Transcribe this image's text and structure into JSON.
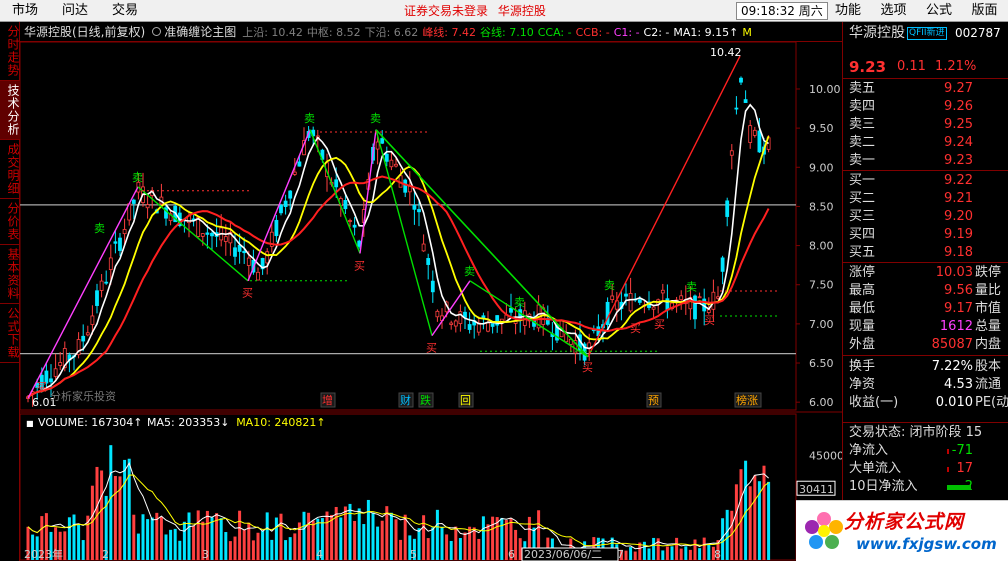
{
  "menu": {
    "left": [
      "市场",
      "问达",
      "交易"
    ],
    "center": [
      "证券交易未登录",
      "华源控股"
    ],
    "clock": "09:18:32 周六",
    "right": [
      "功能",
      "选项",
      "公式",
      "版面"
    ]
  },
  "left_tabs": [
    "分时走势",
    "技术分析",
    "成交明细",
    "分价表",
    "基本资料",
    "公式下载"
  ],
  "chart_header": {
    "stock": "华源控股(日线,前复权)",
    "indicator": "准确缠论主图",
    "legend": [
      {
        "text": "上沿: 10.42",
        "color": "#808080"
      },
      {
        "text": "中枢: 8.52",
        "color": "#808080"
      },
      {
        "text": "下沿: 6.62",
        "color": "#808080"
      },
      {
        "text": "峰线: 7.42",
        "color": "#ff3030"
      },
      {
        "text": "谷线: 7.10",
        "color": "#00e000"
      },
      {
        "text": "CCA: -",
        "color": "#00e000"
      },
      {
        "text": "CCB: -",
        "color": "#ff3030"
      },
      {
        "text": "C1: -",
        "color": "#ff40ff"
      },
      {
        "text": "C2: -",
        "color": "#ffffff"
      },
      {
        "text": "MA1: 9.15↑",
        "color": "#ffffff"
      },
      {
        "text": "M",
        "color": "#ffff00"
      }
    ]
  },
  "price_axis": [
    "10.00",
    "9.50",
    "9.00",
    "8.50",
    "8.00",
    "7.50",
    "7.00",
    "6.50",
    "6.00"
  ],
  "price_labels": {
    "high": "10.42",
    "low": "6.01",
    "watermark_text": "分析家乐投资"
  },
  "event_marks": [
    {
      "text": "增",
      "color": "#ff3030"
    },
    {
      "text": "财",
      "color": "#00bfff"
    },
    {
      "text": "跌",
      "color": "#00e000"
    },
    {
      "text": "回",
      "color": "#ffff00"
    },
    {
      "text": "预",
      "color": "#ffa500"
    },
    {
      "text": "榜涨",
      "color": "#ffa500"
    }
  ],
  "signal_labels": {
    "sell": "卖",
    "buy": "买"
  },
  "volume_header": [
    {
      "text": "VOLUME: 167304↑",
      "color": "#ffffff"
    },
    {
      "text": "MA5: 203353↓",
      "color": "#ffffff"
    },
    {
      "text": "MA10: 240821↑",
      "color": "#ffff00"
    }
  ],
  "volume_axis": [
    "45000",
    "30411",
    "15000"
  ],
  "date_axis": [
    "2023年",
    "2",
    "3",
    "4",
    "5",
    "6",
    "2023/06/06/二",
    "7",
    "8"
  ],
  "quote": {
    "name": "华源控股",
    "badge": "QFII新进",
    "code": "002787",
    "price": "9.23",
    "change": "0.11",
    "pct": "1.21%",
    "asks": [
      {
        "label": "卖五",
        "price": "9.27"
      },
      {
        "label": "卖四",
        "price": "9.26"
      },
      {
        "label": "卖三",
        "price": "9.25"
      },
      {
        "label": "卖二",
        "price": "9.24"
      },
      {
        "label": "卖一",
        "price": "9.23"
      }
    ],
    "bids": [
      {
        "label": "买一",
        "price": "9.22"
      },
      {
        "label": "买二",
        "price": "9.21"
      },
      {
        "label": "买三",
        "price": "9.20"
      },
      {
        "label": "买四",
        "price": "9.19"
      },
      {
        "label": "买五",
        "price": "9.18"
      }
    ],
    "stats": [
      {
        "label": "涨停",
        "value": "10.03",
        "extra": "跌停",
        "color": "#ff3030"
      },
      {
        "label": "最高",
        "value": "9.56",
        "extra": "量比",
        "color": "#ff3030"
      },
      {
        "label": "最低",
        "value": "9.17",
        "extra": "市值",
        "color": "#ff3030"
      },
      {
        "label": "现量",
        "value": "1612",
        "extra": "总量",
        "color": "#ff40ff"
      },
      {
        "label": "外盘",
        "value": "85087",
        "extra": "内盘",
        "color": "#ff3030"
      }
    ],
    "stats2": [
      {
        "label": "换手",
        "value": "7.22%",
        "extra": "股本",
        "color": "#ffffff"
      },
      {
        "label": "净资",
        "value": "4.53",
        "extra": "流通",
        "color": "#ffffff"
      },
      {
        "label": "收益(一)",
        "value": "0.010",
        "extra": "PE(动",
        "color": "#ffffff"
      }
    ],
    "status_label": "交易状态: 闭市阶段 15",
    "flows": [
      {
        "label": "净流入",
        "value": "-71"
      },
      {
        "label": "大单流入",
        "value": "17"
      },
      {
        "label": "10日净流入",
        "value": "-2"
      }
    ]
  },
  "logo": {
    "brand": "分析家公式网",
    "url": "www.fxjgsw.com"
  }
}
